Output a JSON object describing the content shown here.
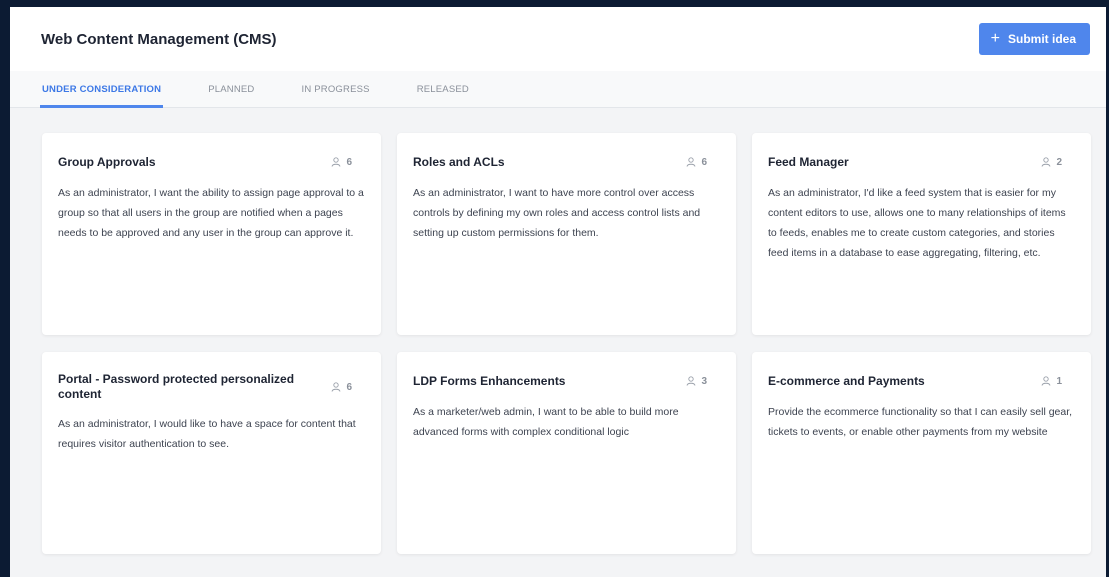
{
  "header": {
    "title": "Web Content Management (CMS)",
    "submit_label": "Submit idea"
  },
  "tabs": [
    {
      "label": "UNDER CONSIDERATION",
      "active": true
    },
    {
      "label": "PLANNED",
      "active": false
    },
    {
      "label": "IN PROGRESS",
      "active": false
    },
    {
      "label": "RELEASED",
      "active": false
    }
  ],
  "cards": [
    {
      "title": "Group Approvals",
      "votes": "6",
      "body": "As an administrator, I want the ability to assign page approval to a group so that all users in the group are notified when a pages needs to be approved and any user in the group can approve it."
    },
    {
      "title": "Roles and ACLs",
      "votes": "6",
      "body": "As an administrator, I want to have more control over access controls by defining my own roles and access control lists and setting up custom permissions for them."
    },
    {
      "title": "Feed Manager",
      "votes": "2",
      "body": "As an administrator, I'd like a feed system that is easier for my content editors to use, allows one to many relationships of items to feeds, enables me to create custom categories, and stories feed items in a database to ease aggregating, filtering, etc."
    },
    {
      "title": "Portal - Password protected personalized content",
      "votes": "6",
      "body": "As an administrator, I would like to have a space for content that requires visitor authentication to see."
    },
    {
      "title": "LDP Forms Enhancements",
      "votes": "3",
      "body": "As a marketer/web admin, I want to be able to build more advanced forms with complex conditional logic"
    },
    {
      "title": "E-commerce and Payments",
      "votes": "1",
      "body": "Provide the ecommerce functionality so that I can easily sell gear, tickets to events, or enable other payments from my website"
    }
  ],
  "colors": {
    "accent": "#4f86ec",
    "background": "#f3f4f6",
    "outer": "#0c1b33"
  },
  "icons": {
    "submit": "plus-icon",
    "votes": "user-icon"
  }
}
